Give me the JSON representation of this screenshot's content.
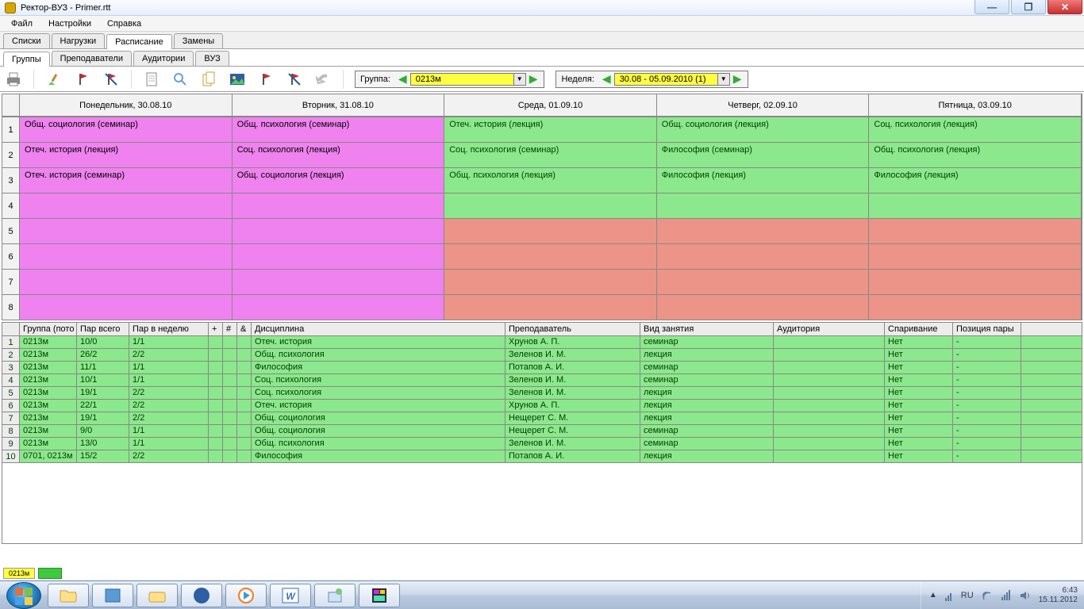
{
  "window": {
    "title": "Ректор-ВУЗ - Primer.rtt"
  },
  "menu": [
    "Файл",
    "Настройки",
    "Справка"
  ],
  "tabs_main": [
    "Списки",
    "Нагрузки",
    "Расписание",
    "Замены"
  ],
  "tabs_main_active": 2,
  "tabs_sub": [
    "Группы",
    "Преподаватели",
    "Аудитории",
    "ВУЗ"
  ],
  "tabs_sub_active": 0,
  "selectors": {
    "group_label": "Группа:",
    "group_value": "0213м",
    "week_label": "Неделя:",
    "week_value": "30.08 - 05.09.2010  (1)"
  },
  "days": [
    "Понедельник, 30.08.10",
    "Вторник, 31.08.10",
    "Среда, 01.09.10",
    "Четверг, 02.09.10",
    "Пятница, 03.09.10"
  ],
  "schedule": [
    [
      {
        "txt": "Общ. социология (семинар)",
        "c": "pink"
      },
      {
        "txt": "Общ. психология (семинар)",
        "c": "pink"
      },
      {
        "txt": "Отеч. история (лекция)",
        "c": "green"
      },
      {
        "txt": "Общ. социология (лекция)",
        "c": "green"
      },
      {
        "txt": "Соц. психология (лекция)",
        "c": "green"
      }
    ],
    [
      {
        "txt": "Отеч. история (лекция)",
        "c": "pink"
      },
      {
        "txt": "Соц. психология (лекция)",
        "c": "pink"
      },
      {
        "txt": "Соц. психология (семинар)",
        "c": "green"
      },
      {
        "txt": "Философия (семинар)",
        "c": "green"
      },
      {
        "txt": "Общ. психология (лекция)",
        "c": "green"
      }
    ],
    [
      {
        "txt": "Отеч. история (семинар)",
        "c": "pink"
      },
      {
        "txt": "Общ. социология (лекция)",
        "c": "pink"
      },
      {
        "txt": "Общ. психология (лекция)",
        "c": "green"
      },
      {
        "txt": "Философия (лекция)",
        "c": "green"
      },
      {
        "txt": "Философия (лекция)",
        "c": "green"
      }
    ],
    [
      {
        "txt": "",
        "c": "pink"
      },
      {
        "txt": "",
        "c": "pink"
      },
      {
        "txt": "",
        "c": "green"
      },
      {
        "txt": "",
        "c": "green"
      },
      {
        "txt": "",
        "c": "green"
      }
    ],
    [
      {
        "txt": "",
        "c": "pink"
      },
      {
        "txt": "",
        "c": "pink"
      },
      {
        "txt": "",
        "c": "salmon"
      },
      {
        "txt": "",
        "c": "salmon"
      },
      {
        "txt": "",
        "c": "salmon"
      }
    ],
    [
      {
        "txt": "",
        "c": "pink"
      },
      {
        "txt": "",
        "c": "pink"
      },
      {
        "txt": "",
        "c": "salmon"
      },
      {
        "txt": "",
        "c": "salmon"
      },
      {
        "txt": "",
        "c": "salmon"
      }
    ],
    [
      {
        "txt": "",
        "c": "pink"
      },
      {
        "txt": "",
        "c": "pink"
      },
      {
        "txt": "",
        "c": "salmon"
      },
      {
        "txt": "",
        "c": "salmon"
      },
      {
        "txt": "",
        "c": "salmon"
      }
    ],
    [
      {
        "txt": "",
        "c": "pink"
      },
      {
        "txt": "",
        "c": "pink"
      },
      {
        "txt": "",
        "c": "salmon"
      },
      {
        "txt": "",
        "c": "salmon"
      },
      {
        "txt": "",
        "c": "salmon"
      }
    ]
  ],
  "bottom_headers": [
    "Группа (пото",
    "Пар всего",
    "Пар в неделю",
    "+",
    "#",
    "&",
    "Дисциплина",
    "Преподаватель",
    "Вид занятия",
    "Аудитория",
    "Спаривание",
    "Позиция пары"
  ],
  "bottom_widths": [
    72,
    66,
    100,
    18,
    18,
    18,
    320,
    170,
    168,
    140,
    86,
    86
  ],
  "bottom_rows": [
    [
      "0213м",
      "10/0",
      "1/1",
      "",
      "",
      "",
      "Отеч. история",
      "Хрунов А. П.",
      "семинар",
      "",
      "Нет",
      "-"
    ],
    [
      "0213м",
      "26/2",
      "2/2",
      "",
      "",
      "",
      "Общ. психология",
      "Зеленов И. М.",
      "лекция",
      "",
      "Нет",
      "-"
    ],
    [
      "0213м",
      "11/1",
      "1/1",
      "",
      "",
      "",
      "Философия",
      "Потапов А. И.",
      "семинар",
      "",
      "Нет",
      "-"
    ],
    [
      "0213м",
      "10/1",
      "1/1",
      "",
      "",
      "",
      "Соц. психология",
      "Зеленов И. М.",
      "семинар",
      "",
      "Нет",
      "-"
    ],
    [
      "0213м",
      "19/1",
      "2/2",
      "",
      "",
      "",
      "Соц. психология",
      "Зеленов И. М.",
      "лекция",
      "",
      "Нет",
      "-"
    ],
    [
      "0213м",
      "22/1",
      "2/2",
      "",
      "",
      "",
      "Отеч. история",
      "Хрунов А. П.",
      "лекция",
      "",
      "Нет",
      "-"
    ],
    [
      "0213м",
      "19/1",
      "2/2",
      "",
      "",
      "",
      "Общ. социология",
      "Нещерет С. М.",
      "лекция",
      "",
      "Нет",
      "-"
    ],
    [
      "0213м",
      "9/0",
      "1/1",
      "",
      "",
      "",
      "Общ. социология",
      "Нещерет С. М.",
      "семинар",
      "",
      "Нет",
      "-"
    ],
    [
      "0213м",
      "13/0",
      "1/1",
      "",
      "",
      "",
      "Общ. психология",
      "Зеленов И. М.",
      "семинар",
      "",
      "Нет",
      "-"
    ],
    [
      "0701, 0213м",
      "15/2",
      "2/2",
      "",
      "",
      "",
      "Философия",
      "Потапов А. И.",
      "лекция",
      "",
      "Нет",
      "-"
    ]
  ],
  "footer": {
    "loz1": "0213м",
    "loz2": " "
  },
  "tray": {
    "lang": "RU",
    "time": "6:43",
    "date": "15.11.2012"
  }
}
